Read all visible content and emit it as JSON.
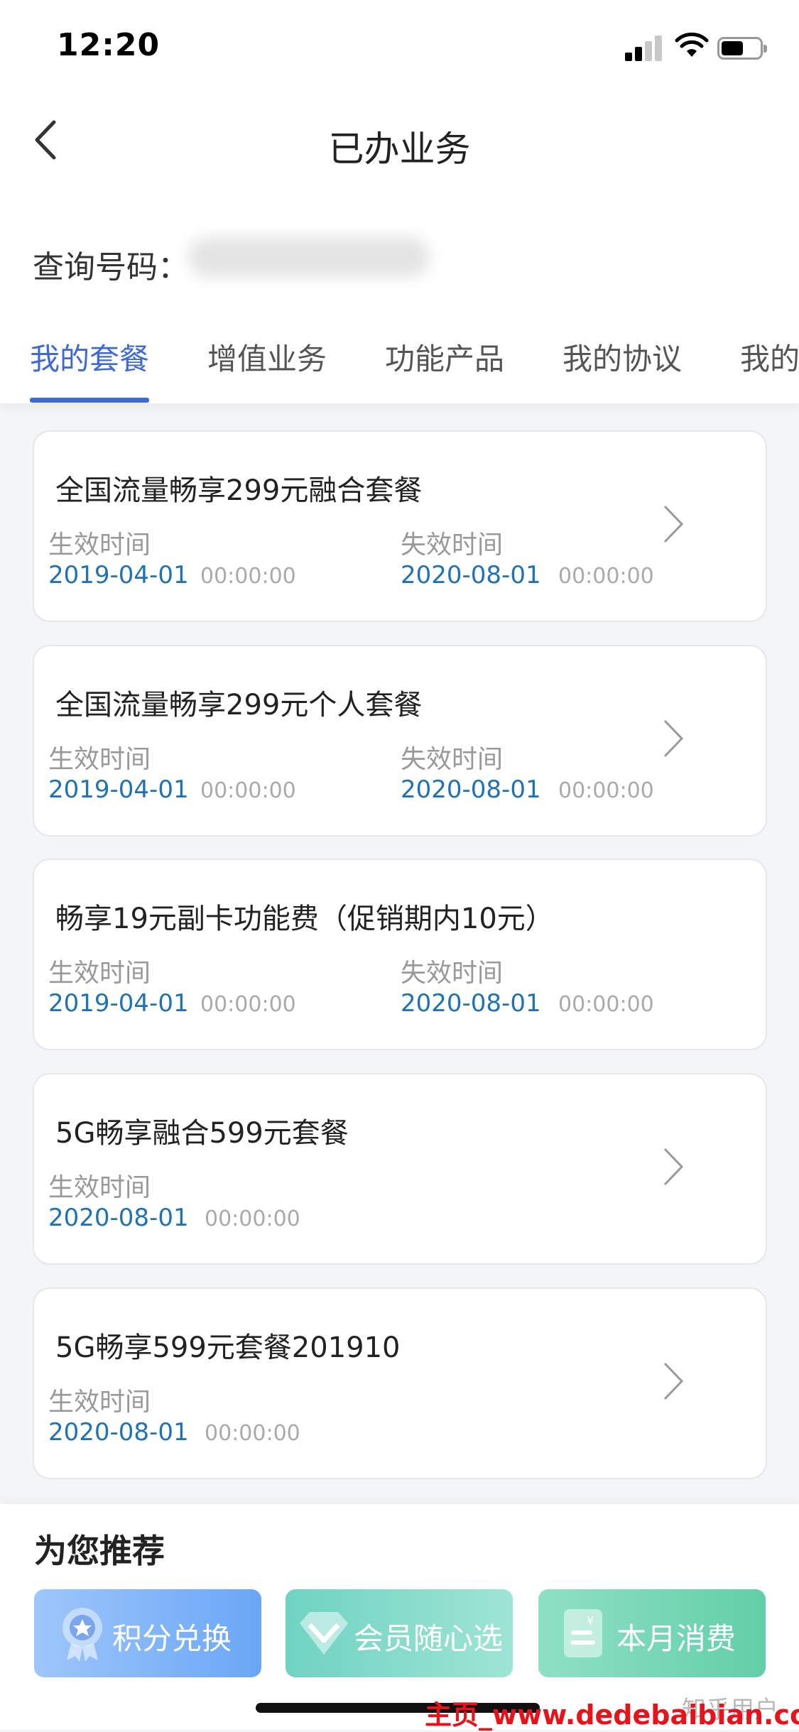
{
  "status_bar": {
    "time": "12:20"
  },
  "header": {
    "title": "已办业务"
  },
  "query": {
    "label": "查询号码："
  },
  "tabs": [
    {
      "label": "我的套餐"
    },
    {
      "label": "增值业务"
    },
    {
      "label": "功能产品"
    },
    {
      "label": "我的协议"
    },
    {
      "label": "我的"
    }
  ],
  "labels": {
    "effective": "生效时间",
    "expiry": "失效时间"
  },
  "cards": [
    {
      "title": "全国流量畅享299元融合套餐",
      "start_date": "2019-04-01",
      "start_time": "00:00:00",
      "end_date": "2020-08-01",
      "end_time": "00:00:00"
    },
    {
      "title": "全国流量畅享299元个人套餐",
      "start_date": "2019-04-01",
      "start_time": "00:00:00",
      "end_date": "2020-08-01",
      "end_time": "00:00:00"
    },
    {
      "title": "畅享19元副卡功能费（促销期内10元）",
      "start_date": "2019-04-01",
      "start_time": "00:00:00",
      "end_date": "2020-08-01",
      "end_time": "00:00:00"
    },
    {
      "title": "5G畅享融合599元套餐",
      "start_date": "2020-08-01",
      "start_time": "00:00:00"
    },
    {
      "title": "5G畅享599元套餐201910",
      "start_date": "2020-08-01",
      "start_time": "00:00:00"
    }
  ],
  "recommend": {
    "title": "为您推荐",
    "items": [
      {
        "label": "积分兑换"
      },
      {
        "label": "会员随心选"
      },
      {
        "label": "本月消费"
      }
    ]
  },
  "watermarks": {
    "zhihu": "知乎用户",
    "site": "主页_www.dedebaibian.com"
  },
  "colors": {
    "accent": "#3e69d6",
    "date": "#1f72b8"
  }
}
